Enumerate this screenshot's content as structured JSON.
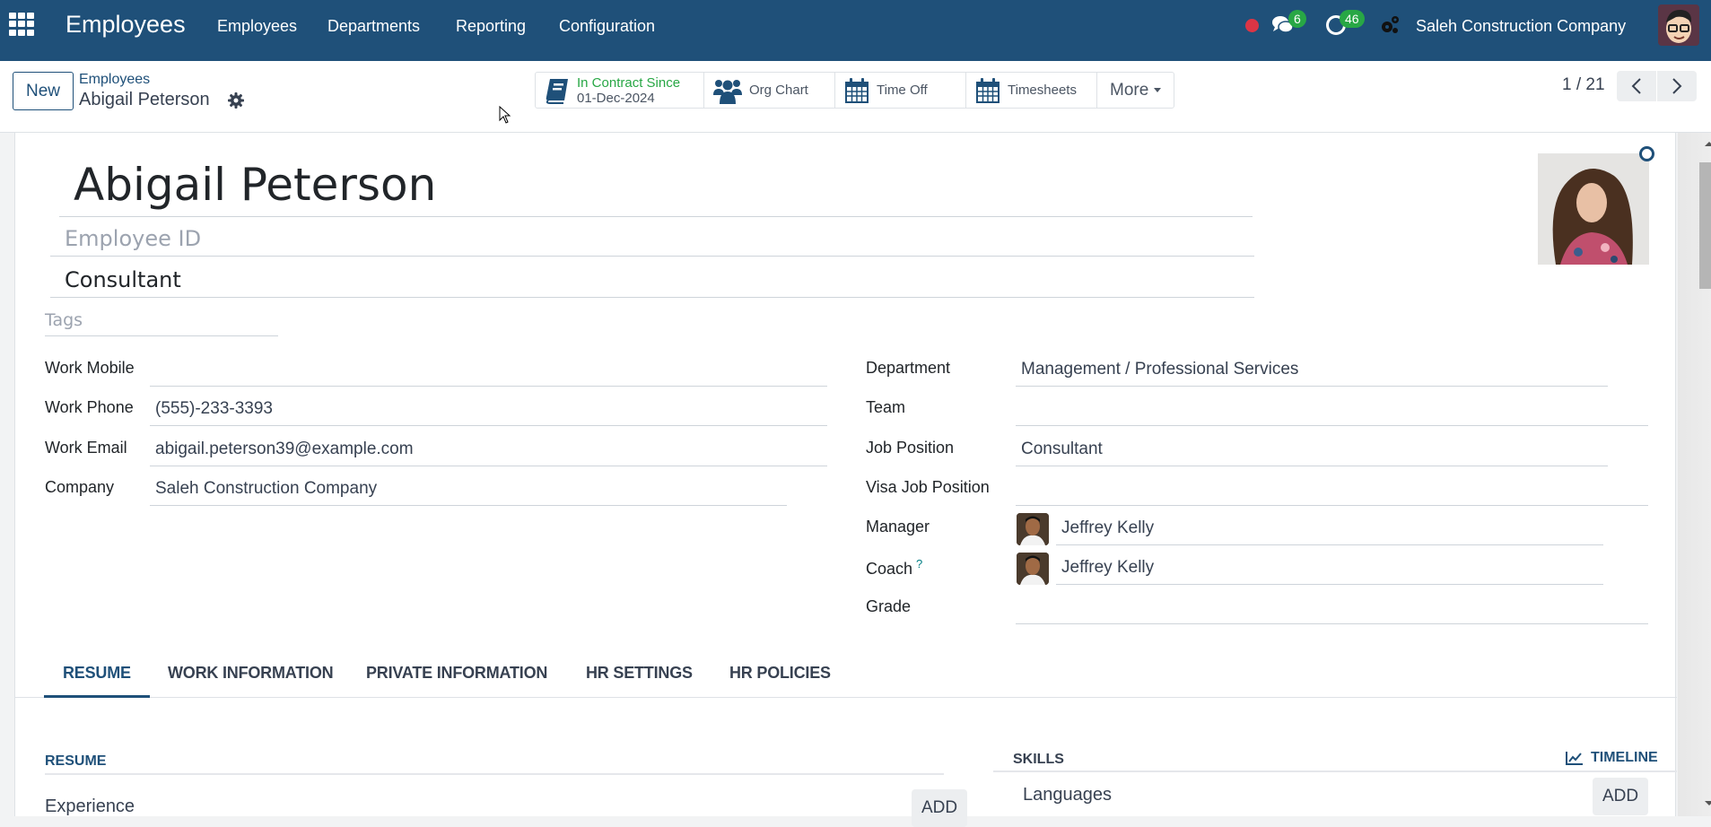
{
  "navbar": {
    "app_title": "Employees",
    "menu": [
      "Employees",
      "Departments",
      "Reporting",
      "Configuration"
    ],
    "messages_count": "6",
    "activities_count": "46",
    "company": "Saleh Construction Company",
    "colors": {
      "navbar_bg": "#1f5079",
      "badge": "#28a745",
      "recording_dot": "#dc3545"
    }
  },
  "control_panel": {
    "new_label": "New",
    "breadcrumb_parent": "Employees",
    "breadcrumb_current": "Abigail Peterson",
    "smart_buttons": {
      "contract_label": "In Contract Since",
      "contract_date": "01-Dec-2024",
      "org_chart": "Org Chart",
      "time_off": "Time Off",
      "timesheets": "Timesheets",
      "more": "More"
    },
    "pager": "1 / 21"
  },
  "form": {
    "name": "Abigail Peterson",
    "employee_id_placeholder": "Employee ID",
    "job_title": "Consultant",
    "tags_placeholder": "Tags",
    "left_fields": [
      {
        "label": "Work Mobile",
        "value": ""
      },
      {
        "label": "Work Phone",
        "value": "(555)-233-3393"
      },
      {
        "label": "Work Email",
        "value": "abigail.peterson39@example.com"
      },
      {
        "label": "Company",
        "value": "Saleh Construction Company"
      }
    ],
    "right_fields": [
      {
        "label": "Department",
        "value": "Management / Professional Services"
      },
      {
        "label": "Team",
        "value": ""
      },
      {
        "label": "Job Position",
        "value": "Consultant"
      },
      {
        "label": "Visa Job Position",
        "value": ""
      },
      {
        "label": "Manager",
        "value": "Jeffrey Kelly"
      },
      {
        "label": "Coach",
        "value": "Jeffrey Kelly",
        "help": "?"
      },
      {
        "label": "Grade",
        "value": ""
      }
    ]
  },
  "tabs": [
    "RESUME",
    "WORK INFORMATION",
    "PRIVATE INFORMATION",
    "HR SETTINGS",
    "HR POLICIES"
  ],
  "active_tab": "RESUME",
  "resume": {
    "title": "RESUME",
    "rows": [
      {
        "label": "Experience",
        "add": "ADD"
      }
    ]
  },
  "skills": {
    "title": "SKILLS",
    "timeline": "TIMELINE",
    "rows": [
      {
        "label": "Languages",
        "add": "ADD"
      }
    ]
  }
}
